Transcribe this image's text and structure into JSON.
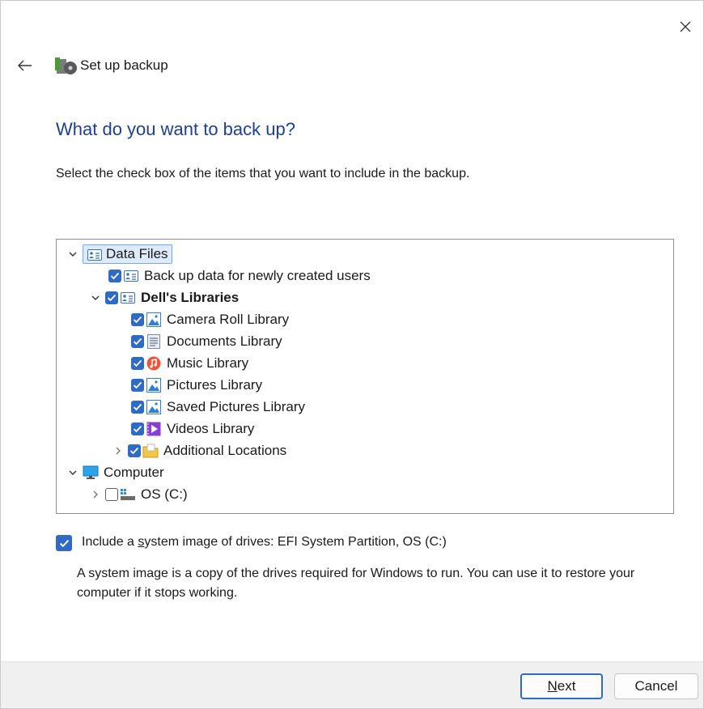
{
  "window": {
    "title": "Set up backup"
  },
  "heading": "What do you want to back up?",
  "instruction": "Select the check box of the items that you want to include in the backup.",
  "tree": {
    "data_files": "Data Files",
    "new_users": "Back up data for newly created users",
    "user_libraries": "Dell's Libraries",
    "camera_roll": "Camera Roll Library",
    "documents": "Documents Library",
    "music": "Music Library",
    "pictures": "Pictures Library",
    "saved_pictures": "Saved Pictures Library",
    "videos": "Videos Library",
    "additional": "Additional Locations",
    "computer": "Computer",
    "os_drive": "OS (C:)"
  },
  "system_image": {
    "checked": true,
    "label_pre": "Include a ",
    "label_mnemonic": "s",
    "label_post": "ystem image of drives: EFI System Partition, OS (C:)",
    "description": "A system image is a copy of the drives required for Windows to run. You can use it to restore your computer if it stops working."
  },
  "buttons": {
    "next_mnemonic": "N",
    "next_rest": "ext",
    "cancel": "Cancel"
  },
  "colors": {
    "accent": "#2f6ac5",
    "heading": "#1f3f93"
  }
}
